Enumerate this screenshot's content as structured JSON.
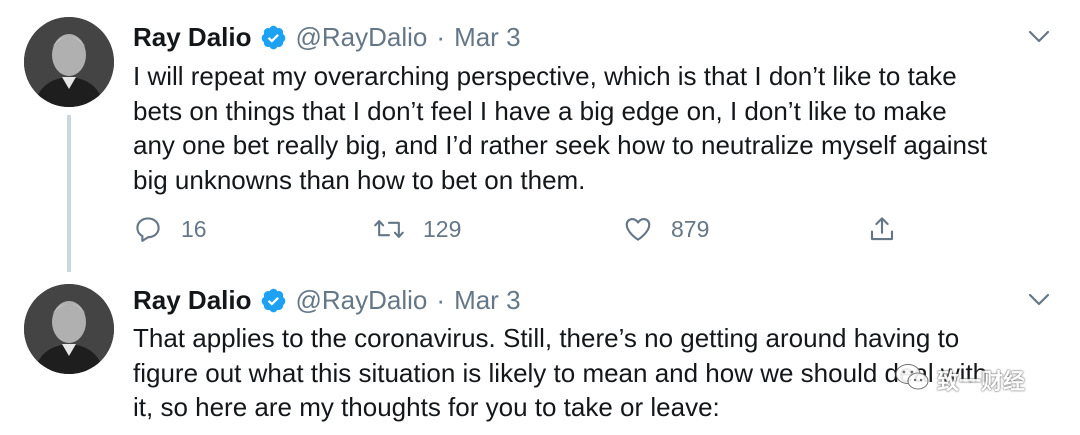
{
  "tweets": [
    {
      "author_name": "Ray Dalio",
      "handle": "@RayDalio",
      "separator": "·",
      "date": "Mar 3",
      "text_lines": [
        "I will repeat my overarching perspective, which is that I don’t like to take",
        "bets on things that I don’t feel I have a big edge on, I don’t like to make",
        "any one bet really big, and I’d rather seek how to neutralize myself against",
        "big unknowns than how to bet on them."
      ],
      "replies": "16",
      "retweets": "129",
      "likes": "879"
    },
    {
      "author_name": "Ray Dalio",
      "handle": "@RayDalio",
      "separator": "·",
      "date": "Mar 3",
      "text_lines": [
        "That applies to the coronavirus. Still, there’s no getting around having to",
        "figure out what this situation is likely to mean and how we should deal with",
        "it, so here are my thoughts for you to take or leave:"
      ]
    }
  ],
  "watermark": {
    "text": "致一财经"
  },
  "icons": {
    "verified": "verified-badge-icon",
    "caret": "chevron-down-icon",
    "reply": "reply-icon",
    "retweet": "retweet-icon",
    "like": "heart-icon",
    "share": "share-icon"
  },
  "colors": {
    "verified": "#1da1f2",
    "secondary_text": "#657786",
    "primary_text": "#14171a",
    "thread_line": "#ccd6dd"
  }
}
